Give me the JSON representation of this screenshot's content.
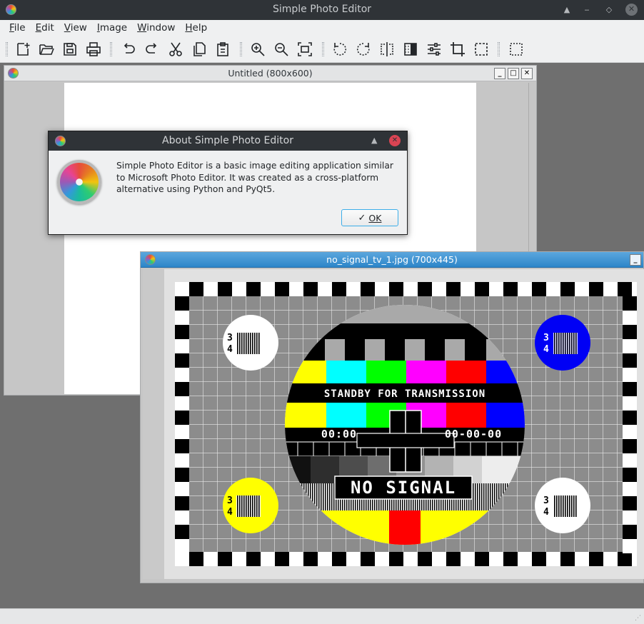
{
  "app": {
    "title": "Simple Photo Editor"
  },
  "menu": [
    "File",
    "Edit",
    "View",
    "Image",
    "Window",
    "Help"
  ],
  "toolbar_icons": [
    "new-file-icon",
    "open-folder-icon",
    "save-icon",
    "print-icon",
    "undo-icon",
    "redo-icon",
    "cut-icon",
    "copy-icon",
    "paste-icon",
    "zoom-in-icon",
    "zoom-out-icon",
    "fit-window-icon",
    "rotate-left-icon",
    "rotate-right-icon",
    "flip-horizontal-icon",
    "invert-icon",
    "adjust-icon",
    "crop-icon",
    "select-icon",
    "select-all-icon"
  ],
  "windows": {
    "untitled": {
      "title": "Untitled (800x600)"
    },
    "image": {
      "title": "no_signal_tv_1.jpg (700x445)"
    }
  },
  "about": {
    "title": "About Simple Photo Editor",
    "message": "Simple Photo Editor is a basic image editing application similar to Microsoft Photo Editor. It was created as a cross-platform alternative using Python and PyQt5.",
    "ok_label": "OK"
  },
  "testcard": {
    "banner": "STANDBY FOR TRANSMISSION",
    "clock": "00:00",
    "date": "00-00-00",
    "no_signal": "NO SIGNAL",
    "corner_digits": [
      "3",
      "4"
    ]
  },
  "colors": {
    "titlebar": "#2f3337",
    "accent": "#3daee9",
    "yellow": "#ffff00",
    "cyan": "#00ffff",
    "green": "#00ff00",
    "magenta": "#ff00ff",
    "red": "#ff0000",
    "blue": "#0000ff"
  }
}
